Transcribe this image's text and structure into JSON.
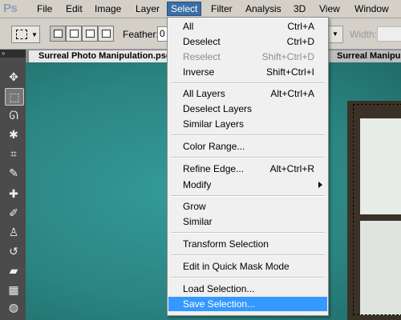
{
  "app": {
    "logo": "Ps"
  },
  "menubar": {
    "items": [
      "File",
      "Edit",
      "Image",
      "Layer",
      "Select",
      "Filter",
      "Analysis",
      "3D",
      "View",
      "Window"
    ],
    "active": "Select"
  },
  "options": {
    "feather_label": "Feather:",
    "feather_value": "0",
    "width_label": "Width:"
  },
  "tabs": [
    {
      "label": "Surreal Photo Manipulation.psd"
    },
    {
      "label": "Surreal Manipul"
    }
  ],
  "tools_panel": {
    "collapse_glyph": "»"
  },
  "select_menu": {
    "items": [
      {
        "label": "All",
        "shortcut": "Ctrl+A",
        "enabled": true
      },
      {
        "label": "Deselect",
        "shortcut": "Ctrl+D",
        "enabled": true
      },
      {
        "label": "Reselect",
        "shortcut": "Shift+Ctrl+D",
        "enabled": false
      },
      {
        "label": "Inverse",
        "shortcut": "Shift+Ctrl+I",
        "enabled": true
      },
      {
        "label": "All Layers",
        "shortcut": "Alt+Ctrl+A",
        "enabled": true
      },
      {
        "label": "Deselect Layers",
        "shortcut": "",
        "enabled": true
      },
      {
        "label": "Similar Layers",
        "shortcut": "",
        "enabled": true
      },
      {
        "label": "Color Range...",
        "shortcut": "",
        "enabled": true
      },
      {
        "label": "Refine Edge...",
        "shortcut": "Alt+Ctrl+R",
        "enabled": true
      },
      {
        "label": "Modify",
        "shortcut": "",
        "enabled": true,
        "submenu": true
      },
      {
        "label": "Grow",
        "shortcut": "",
        "enabled": true
      },
      {
        "label": "Similar",
        "shortcut": "",
        "enabled": true
      },
      {
        "label": "Transform Selection",
        "shortcut": "",
        "enabled": true
      },
      {
        "label": "Edit in Quick Mask Mode",
        "shortcut": "",
        "enabled": true
      },
      {
        "label": "Load Selection...",
        "shortcut": "",
        "enabled": true
      },
      {
        "label": "Save Selection...",
        "shortcut": "",
        "enabled": true,
        "highlighted": true
      }
    ]
  },
  "colors": {
    "menu_highlight": "#3399ff",
    "canvas_teal": "#2b8582",
    "active_menu_bg": "#3a6ea5"
  }
}
